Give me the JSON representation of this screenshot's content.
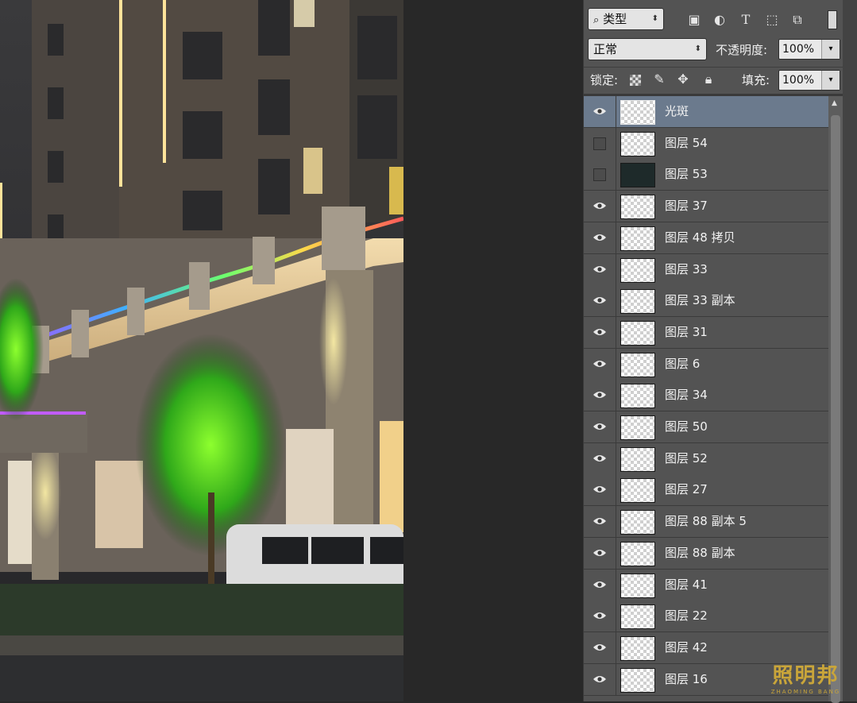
{
  "layers_panel": {
    "filter_kind": "类型",
    "blend_mode": "正常",
    "opacity_label": "不透明度:",
    "opacity_value": "100%",
    "lock_label": "锁定:",
    "fill_label": "填充:",
    "fill_value": "100%",
    "filter_icons": [
      "image-filter-icon",
      "adjustment-filter-icon",
      "type-filter-icon",
      "shape-filter-icon",
      "smart-object-filter-icon"
    ],
    "lock_icons": [
      "lock-transparency-icon",
      "lock-paint-icon",
      "lock-position-icon",
      "lock-all-icon"
    ],
    "layers": [
      {
        "name": "光斑",
        "visible": true,
        "selected": true
      },
      {
        "name": "图层 54",
        "visible": false
      },
      {
        "name": "图层 53",
        "visible": false,
        "dark_thumb": true
      },
      {
        "name": "图层 37",
        "visible": true
      },
      {
        "name": "图层 48 拷贝",
        "visible": true
      },
      {
        "name": "图层 33",
        "visible": true
      },
      {
        "name": "图层 33 副本",
        "visible": true
      },
      {
        "name": "图层 31",
        "visible": true
      },
      {
        "name": "图层 6",
        "visible": true
      },
      {
        "name": "图层 34",
        "visible": true
      },
      {
        "name": "图层 50",
        "visible": true
      },
      {
        "name": "图层 52",
        "visible": true
      },
      {
        "name": "图层 27",
        "visible": true
      },
      {
        "name": "图层 88 副本 5",
        "visible": true
      },
      {
        "name": "图层 88 副本",
        "visible": true
      },
      {
        "name": "图层 41",
        "visible": true
      },
      {
        "name": "图层 22",
        "visible": true
      },
      {
        "name": "图层 42",
        "visible": true
      },
      {
        "name": "图层 16",
        "visible": true
      }
    ]
  },
  "watermark": {
    "title": "照明邦",
    "subtitle": "ZHAOMING BANG"
  },
  "colors": {
    "panel_bg": "#535353",
    "selected_row": "#6b7a8d",
    "accent_gold": "#c9a53a"
  }
}
